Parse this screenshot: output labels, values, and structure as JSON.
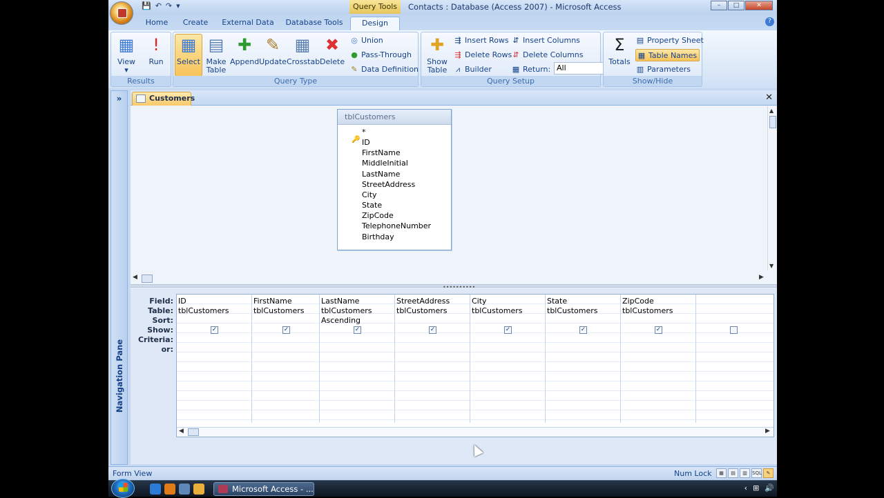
{
  "title": {
    "contextual_label": "Query Tools",
    "window_title": "Contacts : Database (Access 2007) - Microsoft Access",
    "controls": [
      "–",
      "□",
      "✕"
    ]
  },
  "tabs": [
    {
      "label": "Home"
    },
    {
      "label": "Create"
    },
    {
      "label": "External Data"
    },
    {
      "label": "Database Tools"
    },
    {
      "label": "Design",
      "active": true
    }
  ],
  "ribbon": {
    "results": {
      "label": "Results",
      "view": "View",
      "run": "Run"
    },
    "query_type": {
      "label": "Query Type",
      "select": "Select",
      "make_table_1": "Make",
      "make_table_2": "Table",
      "append": "Append",
      "update": "Update",
      "crosstab": "Crosstab",
      "delete": "Delete",
      "union": "Union",
      "pass_through": "Pass-Through",
      "data_definition": "Data Definition"
    },
    "query_setup": {
      "label": "Query Setup",
      "show_table_1": "Show",
      "show_table_2": "Table",
      "insert_rows": "Insert Rows",
      "delete_rows": "Delete Rows",
      "builder": "Builder",
      "insert_columns": "Insert Columns",
      "delete_columns": "Delete Columns",
      "return_label": "Return:",
      "return_value": "All"
    },
    "show_hide": {
      "label": "Show/Hide",
      "totals": "Totals",
      "property_sheet": "Property Sheet",
      "table_names": "Table Names",
      "parameters": "Parameters"
    }
  },
  "nav_pane": {
    "toggle": "»",
    "label": "Navigation Pane"
  },
  "document": {
    "tab_label": "Customers",
    "close": "✕"
  },
  "table_box": {
    "name": "tblCustomers",
    "fields": [
      "*",
      "ID",
      "FirstName",
      "MiddleInitial",
      "LastName",
      "StreetAddress",
      "City",
      "State",
      "ZipCode",
      "TelephoneNumber",
      "Birthday"
    ]
  },
  "grid": {
    "row_labels": {
      "field": "Field:",
      "table": "Table:",
      "sort": "Sort:",
      "show": "Show:",
      "criteria": "Criteria:",
      "or": "or:"
    },
    "columns": [
      {
        "field": "ID",
        "table": "tblCustomers",
        "sort": "",
        "show": true
      },
      {
        "field": "FirstName",
        "table": "tblCustomers",
        "sort": "",
        "show": true
      },
      {
        "field": "LastName",
        "table": "tblCustomers",
        "sort": "Ascending",
        "show": true
      },
      {
        "field": "StreetAddress",
        "table": "tblCustomers",
        "sort": "",
        "show": true
      },
      {
        "field": "City",
        "table": "tblCustomers",
        "sort": "",
        "show": true
      },
      {
        "field": "State",
        "table": "tblCustomers",
        "sort": "",
        "show": true
      },
      {
        "field": "ZipCode",
        "table": "tblCustomers",
        "sort": "",
        "show": true
      },
      {
        "field": "",
        "table": "",
        "sort": "",
        "show": false
      }
    ]
  },
  "status": {
    "left": "Form View",
    "num_lock": "Num Lock",
    "view_icons": [
      "▦",
      "▤",
      "▥",
      "SQL",
      "✎"
    ]
  },
  "taskbar": {
    "task_label": "Microsoft Access - ..."
  }
}
